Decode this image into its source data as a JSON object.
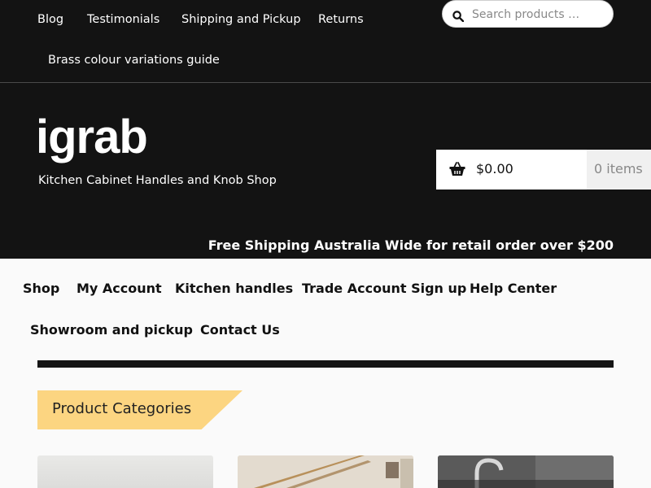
{
  "top_nav": [
    "Blog",
    "Testimonials",
    "Shipping and Pickup",
    "Returns",
    "Brass colour variations guide"
  ],
  "search": {
    "placeholder": "Search products …"
  },
  "site": {
    "logo": "igrab",
    "tagline": "Kitchen Cabinet Handles and Knob Shop"
  },
  "cart": {
    "amount": "$0.00",
    "items": "0 items"
  },
  "promo": "Free Shipping Australia Wide for retail order over $200",
  "main_nav": [
    "Shop",
    "My Account",
    "Kitchen handles",
    "Trade Account Sign up",
    "Help Center",
    "Showroom and pickup",
    "Contact Us"
  ],
  "section": {
    "heading": "Product Categories"
  },
  "colors": {
    "header_bg": "#131313",
    "accent": "#fcd581",
    "page_bg": "#fafafa"
  }
}
